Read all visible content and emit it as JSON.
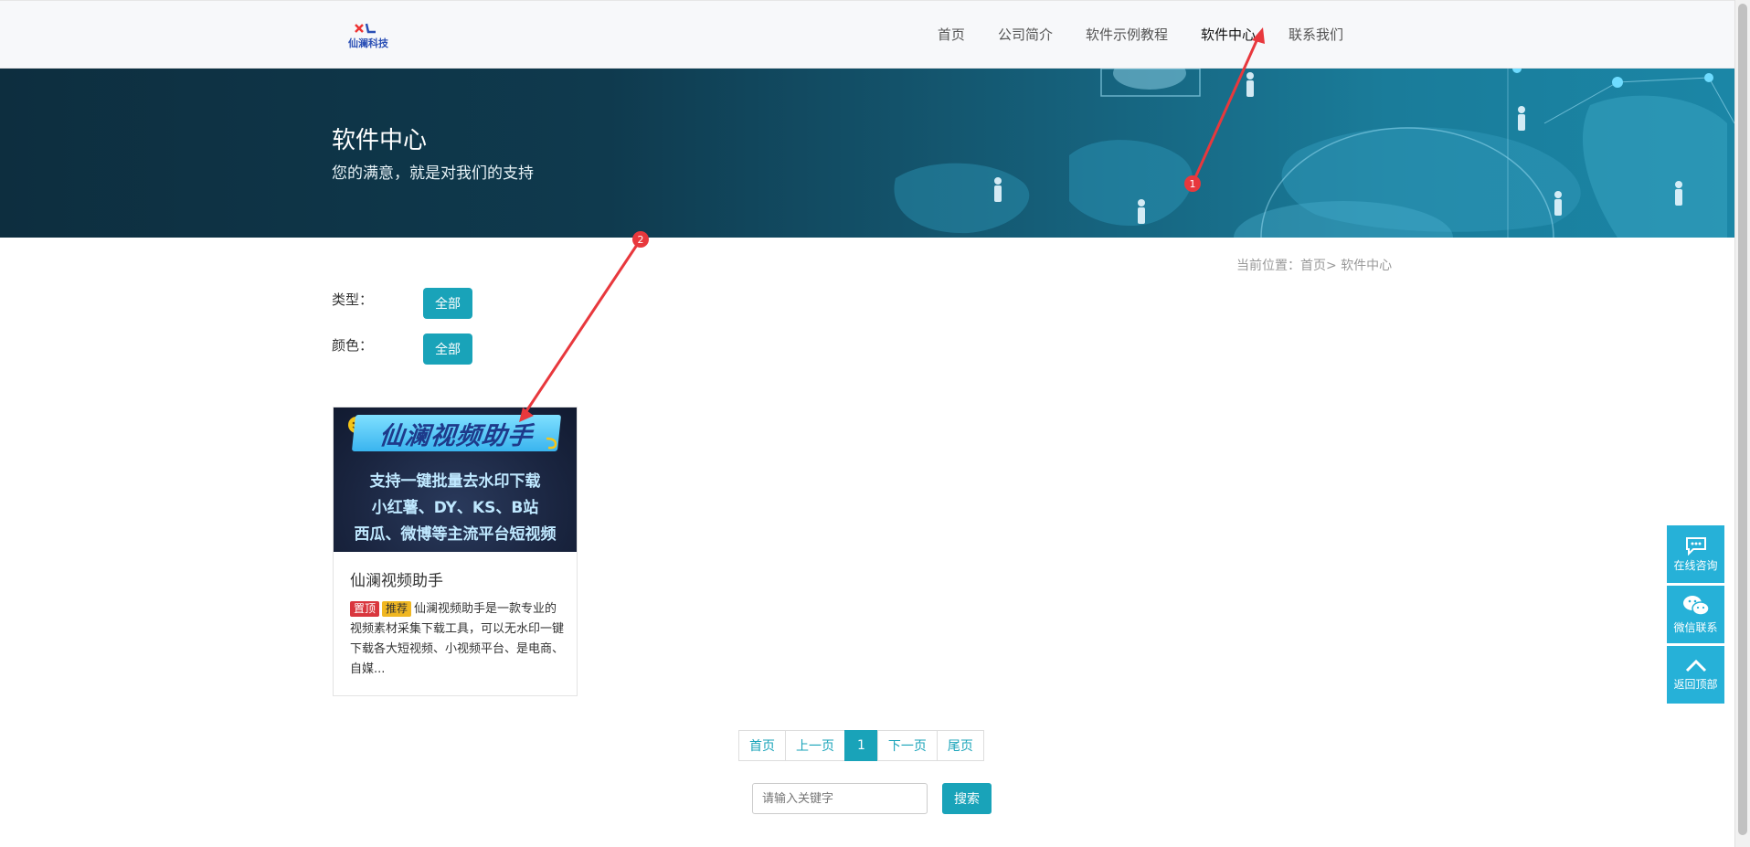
{
  "header": {
    "logo_text": "仙澜科技",
    "nav": [
      {
        "label": "首页"
      },
      {
        "label": "公司简介"
      },
      {
        "label": "软件示例教程"
      },
      {
        "label": "软件中心"
      },
      {
        "label": "联系我们"
      }
    ],
    "active_nav": "软件中心"
  },
  "hero": {
    "title": "软件中心",
    "subtitle": "您的满意，就是对我们的支持"
  },
  "breadcrumb": "当前位置：首页> 软件中心",
  "filters": [
    {
      "label": "类型：",
      "button": "全部"
    },
    {
      "label": "颜色：",
      "button": "全部"
    }
  ],
  "products": [
    {
      "thumb_banner": "仙澜视频助手",
      "thumb_lines": [
        "支持一键批量去水印下载",
        "小红薯、DY、KS、B站",
        "西瓜、微博等主流平台短视频"
      ],
      "title": "仙澜视频助手",
      "tags": [
        "置顶",
        "推荐"
      ],
      "description": "仙澜视频助手是一款专业的视频素材采集下载工具，可以无水印一键下载各大短视频、小视频平台、是电商、自媒..."
    }
  ],
  "pagination": {
    "first": "首页",
    "prev": "上一页",
    "current": "1",
    "next": "下一页",
    "last": "尾页"
  },
  "search": {
    "placeholder": "请输入关键字",
    "button": "搜索"
  },
  "side_tools": [
    {
      "label": "在线咨询",
      "icon": "chat-bubble-icon"
    },
    {
      "label": "微信联系",
      "icon": "wechat-icon"
    },
    {
      "label": "返回顶部",
      "icon": "chevron-up-icon"
    }
  ],
  "annotations": [
    "1",
    "2"
  ],
  "colors": {
    "accent": "#19a3b9",
    "side_tool": "#26b1d8",
    "annotation": "#e8383d",
    "hero_dark": "#0d2e3f"
  }
}
